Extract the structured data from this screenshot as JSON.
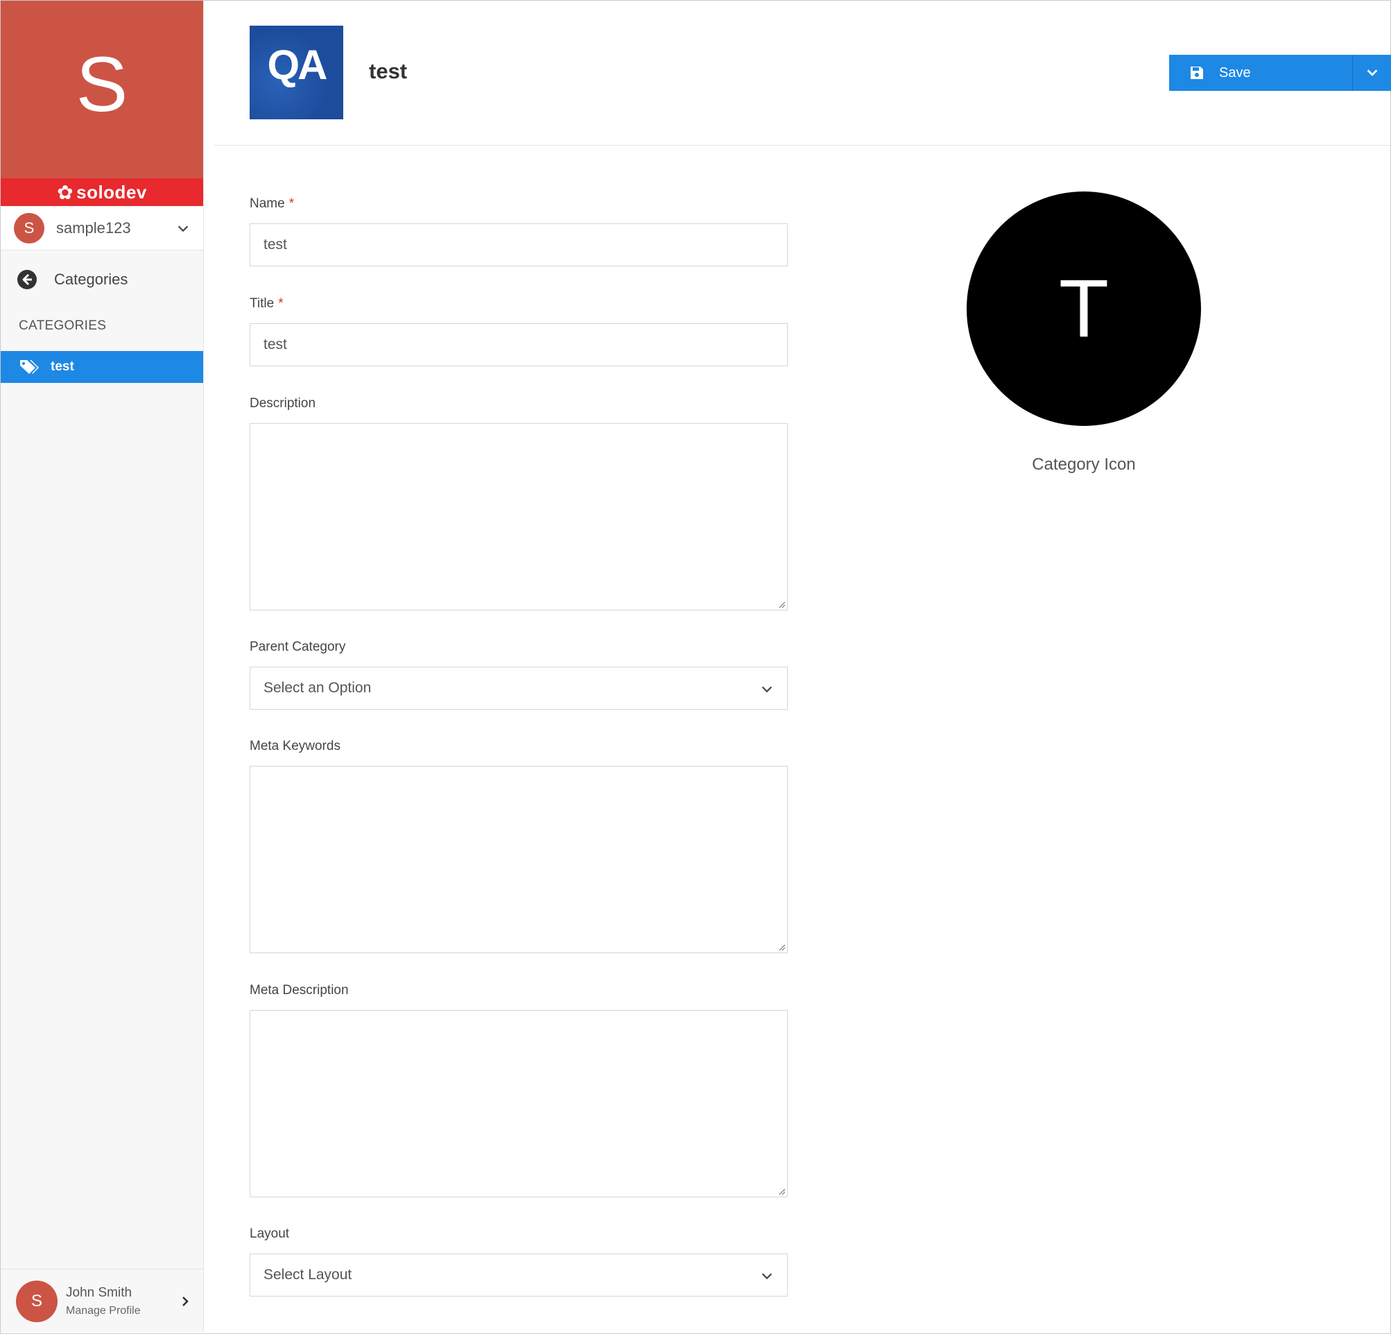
{
  "sidebar": {
    "brand_letter": "S",
    "brand_name": "solodev",
    "site": {
      "avatar_letter": "S",
      "name": "sample123"
    },
    "back_link": "Categories",
    "section_heading": "CATEGORIES",
    "items": [
      {
        "label": "test",
        "active": true
      }
    ],
    "profile": {
      "avatar_letter": "S",
      "name": "John Smith",
      "subtitle": "Manage Profile"
    }
  },
  "header": {
    "logo_text": "QA",
    "title": "test",
    "save_label": "Save"
  },
  "form": {
    "name": {
      "label": "Name",
      "required_mark": "*",
      "value": "test"
    },
    "title": {
      "label": "Title",
      "required_mark": "*",
      "value": "test"
    },
    "description": {
      "label": "Description",
      "value": ""
    },
    "parent_category": {
      "label": "Parent Category",
      "value": "Select an Option"
    },
    "meta_keywords": {
      "label": "Meta Keywords",
      "value": ""
    },
    "meta_description": {
      "label": "Meta Description",
      "value": ""
    },
    "layout": {
      "label": "Layout",
      "value": "Select Layout"
    }
  },
  "category_icon": {
    "letter": "T",
    "caption": "Category Icon"
  },
  "colors": {
    "brand_block": "#cc5445",
    "brand_bar": "#e8292d",
    "accent": "#1e88e5",
    "required": "#e8292d",
    "icon_circle": "#000000"
  }
}
